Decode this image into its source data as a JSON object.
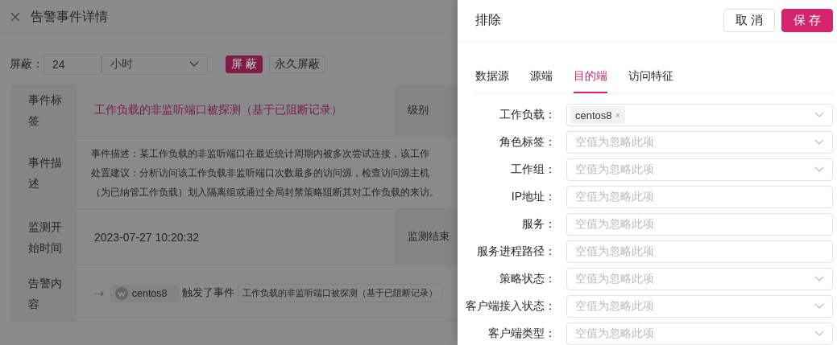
{
  "detail": {
    "title": "告警事件详情",
    "mute": {
      "label": "屏蔽：",
      "value": "24",
      "unit": "小时",
      "buttons": [
        {
          "label": "屏 蔽",
          "kind": "primary"
        },
        {
          "label": "永久屏蔽",
          "kind": "default"
        }
      ]
    },
    "rows": [
      {
        "kind": "pair",
        "label": "事件标签",
        "value": "工作负载的非监听端口被探测（基于已阻断记录）",
        "link": true,
        "label_2": "级别"
      },
      {
        "kind": "lines",
        "label": "事件描述",
        "lines": [
          "事件描述：某工作负载的非监听端口在最近统计周期内被多次尝试连接，该工作",
          "处置建议：分析访问该工作负载非监听端口次数最多的访问源，检查访问源主机",
          "（为已纳管工作负载）划入隔离组或通过全局封禁策略阻断其对工作负载的来访。"
        ]
      },
      {
        "kind": "pair",
        "label": "监测开始时间",
        "value": "2023-07-27 10:20:32",
        "link": false,
        "label_2": "监测结束"
      },
      {
        "kind": "flow",
        "label": "告警内容",
        "arrow": "⇢",
        "host": "centos8",
        "verb": "触发了事件",
        "event": "工作负载的非监听端口被探测（基于已阻断记录）"
      }
    ]
  },
  "drawer": {
    "title": "排除",
    "buttons": [
      {
        "label": "取 消",
        "kind": "default"
      },
      {
        "label": "保 存",
        "kind": "primary"
      }
    ],
    "tabs": [
      {
        "label": "数据源",
        "selected": false
      },
      {
        "label": "源端",
        "selected": false
      },
      {
        "label": "目的端",
        "selected": true
      },
      {
        "label": "访问特征",
        "selected": false
      }
    ],
    "fields": [
      {
        "label": "工作负载：",
        "kind": "select",
        "tags": [
          {
            "label": "centos8",
            "remove": "×"
          }
        ]
      },
      {
        "label": "角色标签：",
        "kind": "select",
        "placeholder": "空值为忽略此项"
      },
      {
        "label": "工作组：",
        "kind": "select",
        "placeholder": "空值为忽略此项"
      },
      {
        "label": "IP地址：",
        "kind": "input",
        "placeholder": "空值为忽略此项"
      },
      {
        "label": "服务：",
        "kind": "input",
        "placeholder": "空值为忽略此项"
      },
      {
        "label": "服务进程路径：",
        "kind": "input",
        "placeholder": "空值为忽略此项"
      },
      {
        "label": "策略状态：",
        "kind": "select",
        "placeholder": "空值为忽略此项"
      },
      {
        "label": "客户端接入状态：",
        "kind": "select",
        "placeholder": "空值为忽略此项"
      },
      {
        "label": "客户端类型：",
        "kind": "select",
        "placeholder": "空值为忽略此项"
      }
    ]
  }
}
